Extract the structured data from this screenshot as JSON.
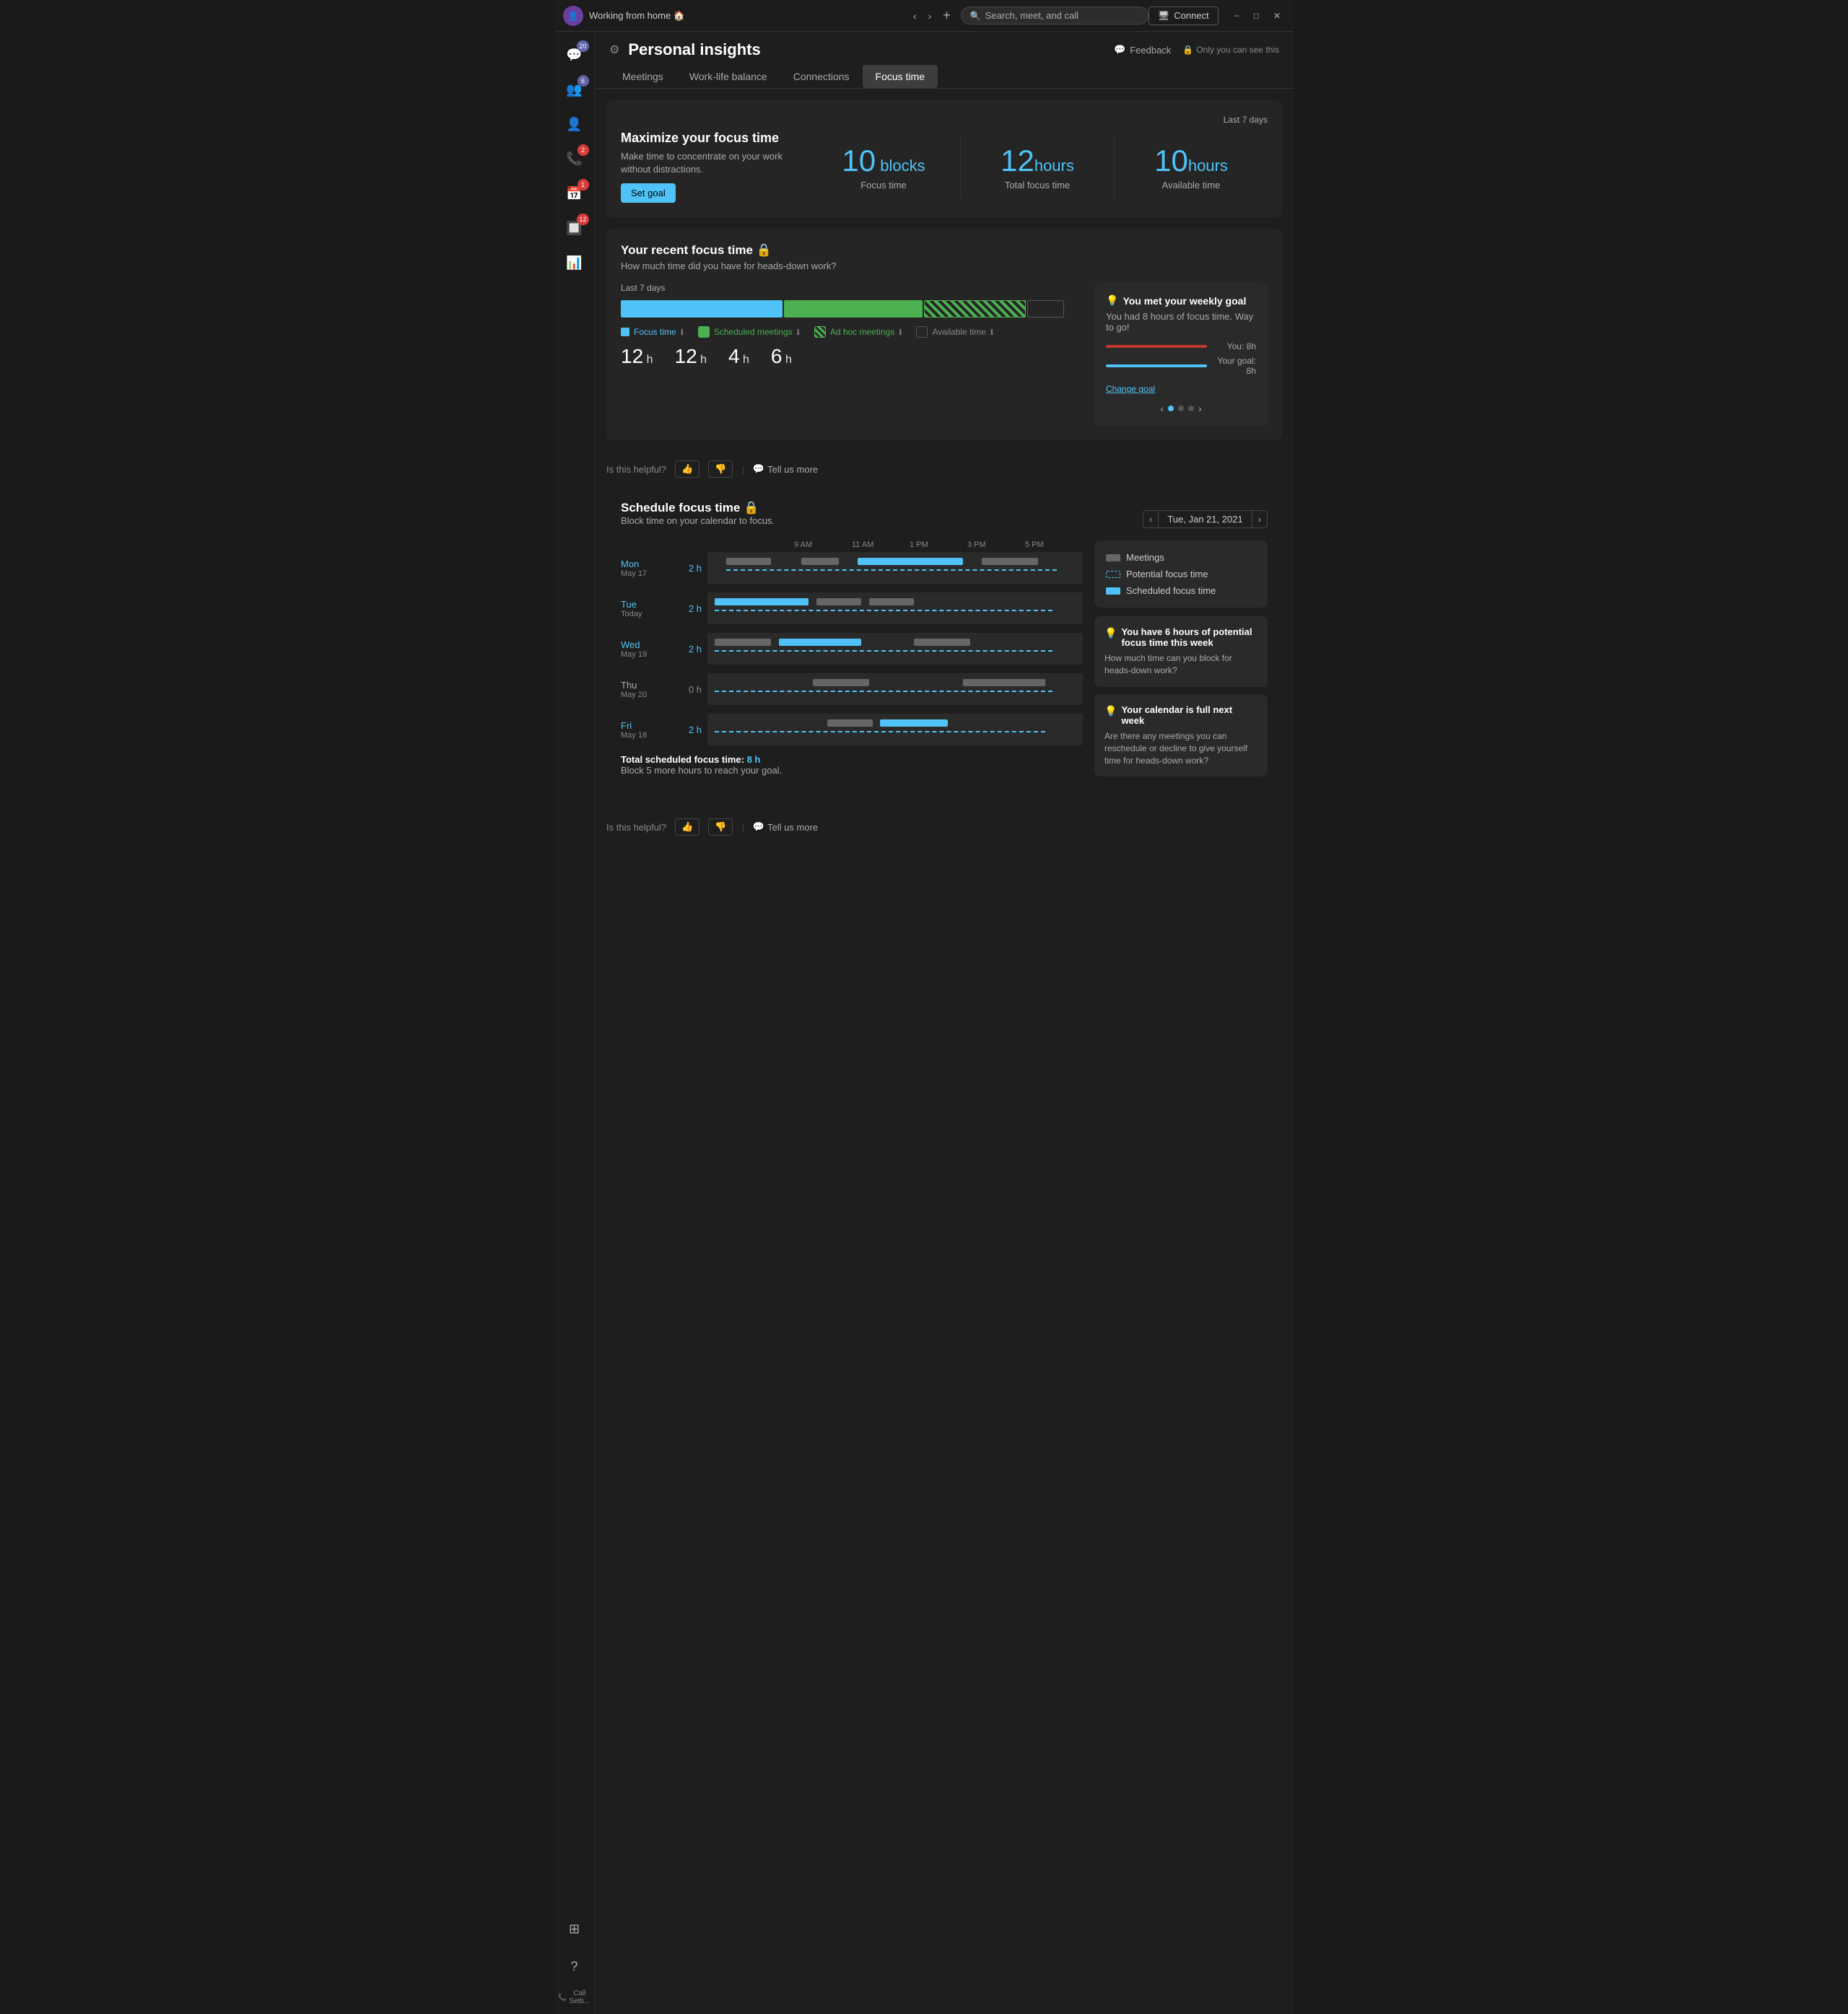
{
  "titleBar": {
    "title": "Working from home 🏠",
    "searchPlaceholder": "Search, meet, and call",
    "connectLabel": "Connect"
  },
  "sidebar": {
    "items": [
      {
        "id": "chat",
        "icon": "💬",
        "badge": "20",
        "badgeColor": "purple"
      },
      {
        "id": "teams",
        "icon": "👥",
        "badge": "6",
        "badgeColor": "purple"
      },
      {
        "id": "contacts",
        "icon": "👤",
        "badge": null
      },
      {
        "id": "calls",
        "icon": "📞",
        "badge": "2",
        "badgeColor": "red"
      },
      {
        "id": "calendar",
        "icon": "📅",
        "badge": "1",
        "badgeColor": "red"
      },
      {
        "id": "apps",
        "icon": "🔲",
        "badge": "12",
        "badgeColor": "red"
      },
      {
        "id": "insights",
        "icon": "📊",
        "badge": null,
        "active": true
      }
    ],
    "bottomItems": [
      {
        "id": "grid",
        "icon": "⊞"
      },
      {
        "id": "help",
        "icon": "?"
      }
    ],
    "callSettings": "Call Setti..."
  },
  "header": {
    "title": "Personal insights",
    "feedbackLabel": "Feedback",
    "onlyYouLabel": "Only you can see this"
  },
  "tabs": [
    {
      "id": "meetings",
      "label": "Meetings"
    },
    {
      "id": "worklife",
      "label": "Work-life balance"
    },
    {
      "id": "connections",
      "label": "Connections"
    },
    {
      "id": "focustime",
      "label": "Focus time",
      "active": true
    }
  ],
  "focusSection": {
    "lastPeriod": "Last 7 days",
    "title": "Maximize your focus time",
    "subtitle": "Make time to concentrate on your work without distractions.",
    "setGoalLabel": "Set goal",
    "stats": [
      {
        "value": "10",
        "unit": "blocks",
        "label": "Focus time"
      },
      {
        "value": "12",
        "unit": "hours",
        "label": "Total focus time"
      },
      {
        "value": "10",
        "unit": "hours",
        "label": "Available time"
      }
    ]
  },
  "recentFocus": {
    "title": "Your recent focus time 🔒",
    "subtitle": "How much time did you have for heads-down work?",
    "period": "Last 7 days",
    "metrics": [
      {
        "value": "12",
        "unit": "h",
        "label": "Focus time",
        "color": "blue"
      },
      {
        "value": "12",
        "unit": "h",
        "label": "Scheduled meetings",
        "color": "green"
      },
      {
        "value": "4",
        "unit": "h",
        "label": "Ad hoc meetings",
        "color": "green-h"
      },
      {
        "value": "6",
        "unit": "h",
        "label": "Available time",
        "color": "gray"
      }
    ],
    "bars": [
      {
        "type": "blue",
        "width": "35%"
      },
      {
        "type": "green",
        "width": "32%"
      },
      {
        "type": "green-h",
        "width": "22%"
      },
      {
        "type": "empty",
        "width": "8%"
      }
    ]
  },
  "goalCard": {
    "title": "You met your weekly goal",
    "subtitle": "You had 8 hours of focus time. Way to go!",
    "you": "You: 8h",
    "goal": "Your goal: 8h",
    "changeGoalLabel": "Change goal"
  },
  "helpful": {
    "label": "Is this helpful?",
    "thumbsUp": "👍",
    "thumbsDown": "👎",
    "tellMore": "Tell us more"
  },
  "schedule": {
    "title": "Schedule focus time 🔒",
    "subtitle": "Block time on your calendar to focus.",
    "dateLabel": "Tue, Jan 21, 2021",
    "timeHeaders": [
      "9 AM",
      "11 AM",
      "1 PM",
      "3 PM",
      "5 PM"
    ],
    "days": [
      {
        "name": "Mon",
        "date": "May 17",
        "hours": "2 h",
        "active": true
      },
      {
        "name": "Tue",
        "date": "Today",
        "hours": "2 h",
        "active": true
      },
      {
        "name": "Wed",
        "date": "May 19",
        "hours": "2 h",
        "active": true
      },
      {
        "name": "Thu",
        "date": "May 20",
        "hours": "0 h",
        "active": false
      },
      {
        "name": "Fri",
        "date": "May 18",
        "hours": "2 h",
        "active": true
      }
    ],
    "legend": [
      {
        "type": "meeting",
        "label": "Meetings"
      },
      {
        "type": "potential",
        "label": "Potential focus time"
      },
      {
        "type": "scheduled",
        "label": "Scheduled focus time"
      }
    ],
    "totalLabel": "Total scheduled focus time:",
    "totalHours": "8 h",
    "totalSubtitle": "Block 5 more hours to reach your goal."
  },
  "insights": [
    {
      "title": "You have 6 hours of potential focus time this week",
      "text": "How much time can you block for heads-down work?"
    },
    {
      "title": "Your calendar is full next week",
      "text": "Are there any meetings you can reschedule or decline to give yourself time for heads-down work?"
    }
  ]
}
